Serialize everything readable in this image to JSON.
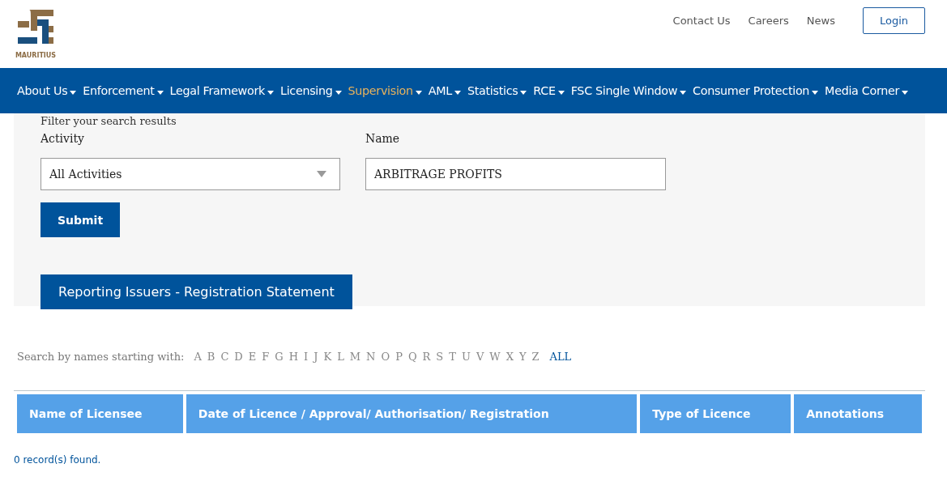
{
  "logo": {
    "caption": "MAURITIUS"
  },
  "top_links": [
    {
      "label": "Contact Us"
    },
    {
      "label": "Careers"
    },
    {
      "label": "News"
    }
  ],
  "login": {
    "label": "Login"
  },
  "nav": [
    {
      "label": "About Us",
      "selected": false
    },
    {
      "label": "Enforcement",
      "selected": false
    },
    {
      "label": "Legal Framework",
      "selected": false
    },
    {
      "label": "Licensing",
      "selected": false
    },
    {
      "label": "Supervision",
      "selected": true
    },
    {
      "label": "AML",
      "selected": false
    },
    {
      "label": "Statistics",
      "selected": false
    },
    {
      "label": "RCE",
      "selected": false
    },
    {
      "label": "FSC Single Window",
      "selected": false
    },
    {
      "label": "Consumer Protection",
      "selected": false
    },
    {
      "label": "Media Corner",
      "selected": false
    }
  ],
  "filter": {
    "heading": "Filter your search results",
    "activity_label": "Activity",
    "activity_value": "All Activities",
    "name_label": "Name",
    "name_value": "ARBITRAGE PROFITS",
    "submit": "Submit",
    "statement_button": "Reporting Issuers - Registration Statement"
  },
  "alpha": {
    "label": "Search by names starting with:",
    "letters": [
      {
        "label": "A",
        "selected": false
      },
      {
        "label": "B",
        "selected": false
      },
      {
        "label": "C",
        "selected": false
      },
      {
        "label": "D",
        "selected": false
      },
      {
        "label": "E",
        "selected": false
      },
      {
        "label": "F",
        "selected": false
      },
      {
        "label": "G",
        "selected": false
      },
      {
        "label": "H",
        "selected": false
      },
      {
        "label": "I",
        "selected": false
      },
      {
        "label": "J",
        "selected": false
      },
      {
        "label": "K",
        "selected": false
      },
      {
        "label": "L",
        "selected": false
      },
      {
        "label": "M",
        "selected": false
      },
      {
        "label": "N",
        "selected": false
      },
      {
        "label": "O",
        "selected": false
      },
      {
        "label": "P",
        "selected": false
      },
      {
        "label": "Q",
        "selected": false
      },
      {
        "label": "R",
        "selected": false
      },
      {
        "label": "S",
        "selected": false
      },
      {
        "label": "T",
        "selected": false
      },
      {
        "label": "U",
        "selected": false
      },
      {
        "label": "V",
        "selected": false
      },
      {
        "label": "W",
        "selected": false
      },
      {
        "label": "X",
        "selected": false
      },
      {
        "label": "Y",
        "selected": false
      },
      {
        "label": "Z",
        "selected": false
      },
      {
        "label": "ALL",
        "selected": true
      }
    ]
  },
  "table": {
    "columns": [
      "Name of Licensee",
      "Date of Licence / Approval/ Authorisation/ Registration",
      "Type of Licence",
      "Annotations"
    ]
  },
  "status": "0 record(s) found."
}
